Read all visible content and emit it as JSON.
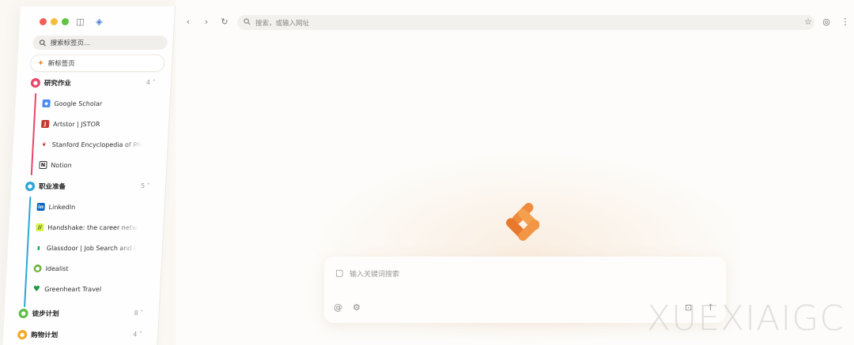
{
  "sidebar": {
    "search_placeholder": "搜索标签页...",
    "new_tab_label": "新标签页",
    "groups": [
      {
        "name": "研究作业",
        "count": "4",
        "color": "#e9456a",
        "expanded": true,
        "tabs": [
          {
            "title": "Google Scholar",
            "icon": "google-scholar-icon"
          },
          {
            "title": "Artstor | JSTOR",
            "icon": "jstor-icon"
          },
          {
            "title": "Stanford Encyclopedia of Phil",
            "icon": "stanford-icon"
          },
          {
            "title": "Notion",
            "icon": "notion-icon"
          }
        ]
      },
      {
        "name": "职业准备",
        "count": "5",
        "color": "#2aa7d6",
        "expanded": true,
        "tabs": [
          {
            "title": "LinkedIn",
            "icon": "linkedin-icon"
          },
          {
            "title": "Handshake: the career networ",
            "icon": "handshake-icon"
          },
          {
            "title": "Glassdoor | Job Search and C",
            "icon": "glassdoor-icon"
          },
          {
            "title": "Idealist",
            "icon": "idealist-icon"
          },
          {
            "title": "Greenheart Travel",
            "icon": "heart-icon"
          }
        ]
      },
      {
        "name": "徒步计划",
        "count": "8",
        "color": "#5fbf4a",
        "expanded": false,
        "tabs": []
      },
      {
        "name": "购物计划",
        "count": "4",
        "color": "#f3a823",
        "expanded": false,
        "tabs": []
      }
    ]
  },
  "toolbar": {
    "address_placeholder": "搜索，或输入网址"
  },
  "main": {
    "query_placeholder": "输入关键词搜索",
    "watermark": "XUEXIAIGC"
  },
  "colors": {
    "accent": "#f08a3c",
    "background": "#fdfcfa"
  }
}
